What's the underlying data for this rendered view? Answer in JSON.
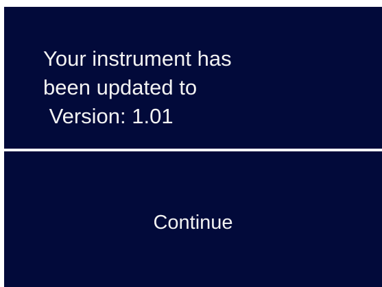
{
  "dialog": {
    "message_lines": [
      "Your instrument has",
      "been updated to",
      " Version: 1.01"
    ],
    "continue_label": "Continue"
  },
  "colors": {
    "panel_background": "#020a3a",
    "text": "#f2f2f2",
    "divider": "#ffffff"
  }
}
